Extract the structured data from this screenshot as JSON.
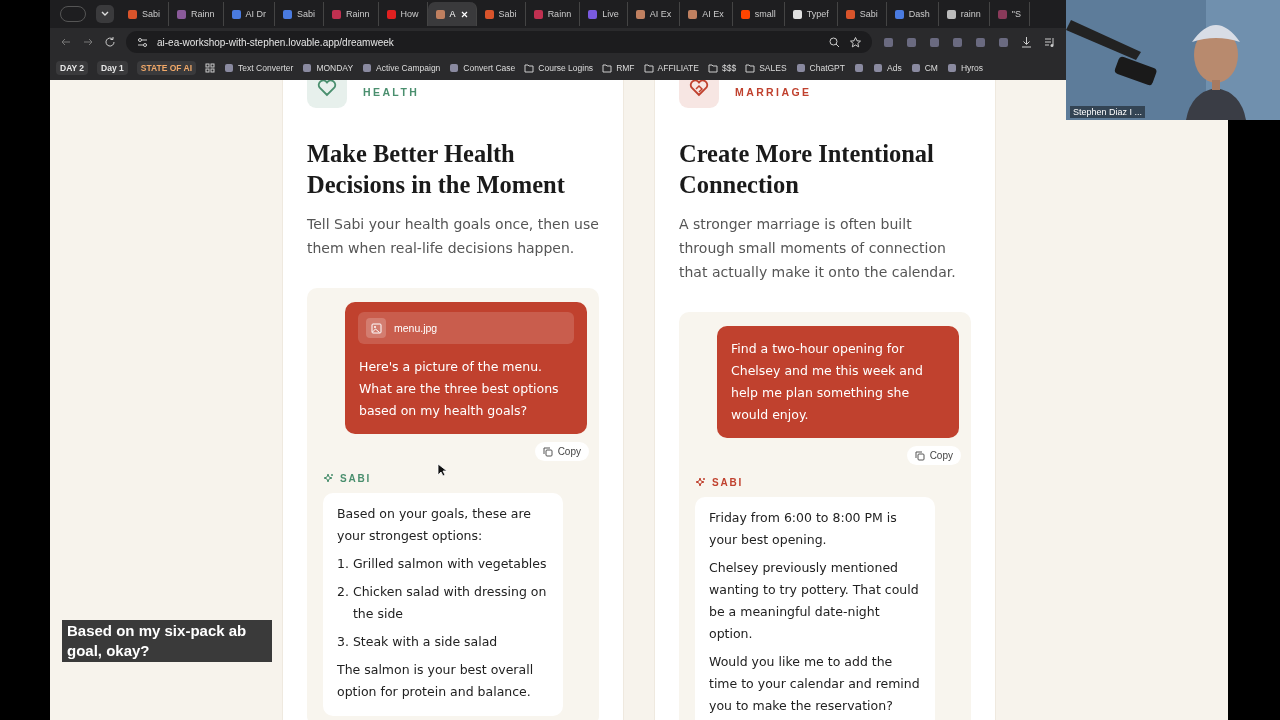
{
  "browser": {
    "tabs": [
      {
        "title": "Sabi",
        "color": "#d9542b",
        "selected": false
      },
      {
        "title": "Rainn",
        "color": "#8a5a9a",
        "selected": false
      },
      {
        "title": "AI Dr",
        "color": "#4a7be0",
        "selected": false
      },
      {
        "title": "Sabi",
        "color": "#4a7be0",
        "selected": false
      },
      {
        "title": "Rainn",
        "color": "#c03050",
        "selected": false
      },
      {
        "title": "How",
        "color": "#e02020",
        "selected": false
      },
      {
        "title": "A",
        "color": "#c08060",
        "selected": true
      },
      {
        "title": "Sabi",
        "color": "#d9542b",
        "selected": false
      },
      {
        "title": "Rainn",
        "color": "#c03050",
        "selected": false
      },
      {
        "title": "Live",
        "color": "#7a5ae0",
        "selected": false
      },
      {
        "title": "AI Ex",
        "color": "#c08060",
        "selected": false
      },
      {
        "title": "AI Ex",
        "color": "#c08060",
        "selected": false
      },
      {
        "title": "small",
        "color": "#ff4500",
        "selected": false
      },
      {
        "title": "Typef",
        "color": "#e0e0e0",
        "selected": false
      },
      {
        "title": "Sabi",
        "color": "#d9542b",
        "selected": false
      },
      {
        "title": "Dash",
        "color": "#4a7be0",
        "selected": false
      },
      {
        "title": "rainn",
        "color": "#bbbbbb",
        "selected": false
      },
      {
        "title": "\"S",
        "color": "#8a3a5a",
        "selected": false
      }
    ],
    "url": "ai-ea-workshop-with-stephen.lovable.app/dreamweek",
    "bookmarks": [
      {
        "kind": "chip",
        "label": "DAY 2",
        "color": "#e8e8e8"
      },
      {
        "kind": "chip",
        "label": "Day 1",
        "color": "#e8e8e8"
      },
      {
        "kind": "chip",
        "label": "STATE OF AI",
        "color": "#f0a868"
      },
      {
        "kind": "grid"
      },
      {
        "kind": "site",
        "label": "Text Converter"
      },
      {
        "kind": "site",
        "label": "MONDAY"
      },
      {
        "kind": "site",
        "label": "Active Campaign"
      },
      {
        "kind": "site",
        "label": "Convert Case"
      },
      {
        "kind": "folder",
        "label": "Course Logins"
      },
      {
        "kind": "folder",
        "label": "RMF"
      },
      {
        "kind": "folder",
        "label": "AFFILIATE"
      },
      {
        "kind": "folder",
        "label": "$$$"
      },
      {
        "kind": "folder",
        "label": "SALES"
      },
      {
        "kind": "site",
        "label": "ChatGPT"
      },
      {
        "kind": "site"
      },
      {
        "kind": "site",
        "label": "Ads"
      },
      {
        "kind": "site",
        "label": "CM"
      },
      {
        "kind": "site",
        "label": "Hyros"
      }
    ]
  },
  "video": {
    "name": "Stephen Diaz I ..."
  },
  "cards": [
    {
      "category": "HEALTH",
      "color": "#4a8f6e",
      "title": "Make Better Health Decisions in the Moment",
      "description": "Tell Sabi your health goals once, then use them when real-life decisions happen.",
      "message": {
        "attachment": "menu.jpg",
        "text": "Here's a picture of the menu. What are the three best options based on my health goals?"
      },
      "copy": "Copy",
      "reply_label": "SABI",
      "reply": [
        {
          "kind": "para",
          "text": "Based on your goals, these are your strongest options:"
        },
        {
          "kind": "list",
          "items": [
            {
              "number": "1.",
              "text": "Grilled salmon with vegetables"
            },
            {
              "number": "2.",
              "text": "Chicken salad with dressing on the side"
            },
            {
              "number": "3.",
              "text": "Steak with a side salad"
            }
          ]
        },
        {
          "kind": "para",
          "text": "The salmon is your best overall option for protein and balance."
        }
      ]
    },
    {
      "category": "MARRIAGE",
      "color": "#c0412e",
      "title": "Create More Intentional Connection",
      "description": "A stronger marriage is often built through small moments of connection that actually make it onto the calendar.",
      "message": {
        "text": "Find a two-hour opening for Chelsey and me this week and help me plan something she would enjoy."
      },
      "copy": "Copy",
      "reply_label": "SABI",
      "reply": [
        {
          "kind": "para",
          "text": "Friday from 6:00 to 8:00 PM is your best opening."
        },
        {
          "kind": "para",
          "text": "Chelsey previously mentioned wanting to try pottery. That could be a meaningful date-night option."
        },
        {
          "kind": "para",
          "text": "Would you like me to add the time to your calendar and remind you to make the reservation?"
        }
      ]
    }
  ],
  "caption": "Based on my six-pack ab goal, okay?"
}
